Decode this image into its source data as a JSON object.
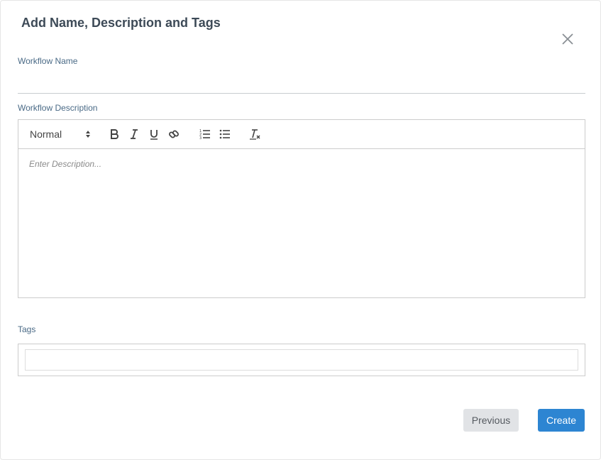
{
  "dialog": {
    "title": "Add Name, Description and Tags",
    "close_icon": "close-icon"
  },
  "workflow_name": {
    "label": "Workflow Name",
    "value": ""
  },
  "workflow_description": {
    "label": "Workflow Description",
    "toolbar": {
      "format": "Normal",
      "icons": [
        "chevron-updown-icon",
        "bold-icon",
        "italic-icon",
        "underline-icon",
        "link-icon",
        "ordered-list-icon",
        "bullet-list-icon",
        "clear-format-icon"
      ]
    },
    "placeholder": "Enter Description..."
  },
  "tags": {
    "label": "Tags",
    "value": ""
  },
  "buttons": {
    "previous": "Previous",
    "create": "Create"
  },
  "colors": {
    "primary": "#2d85d2",
    "secondary_button": "#e1e3e6",
    "label": "#4a6a86",
    "title": "#3d4a57"
  }
}
